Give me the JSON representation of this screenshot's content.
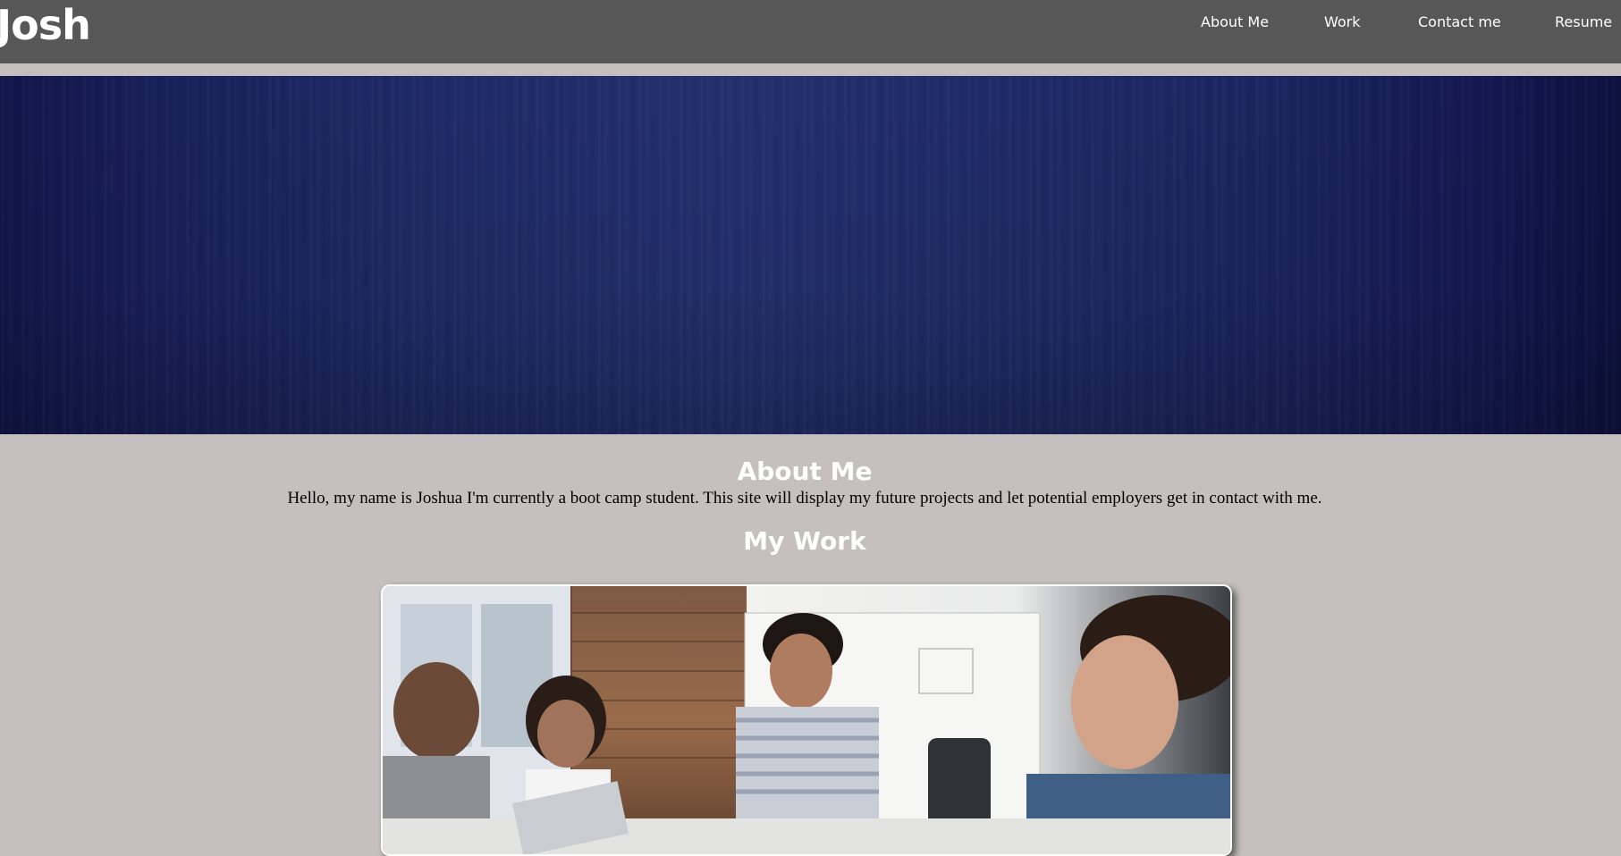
{
  "navbar": {
    "brand": "Josh",
    "links": [
      {
        "label": "About Me"
      },
      {
        "label": "Work"
      },
      {
        "label": "Contact me"
      },
      {
        "label": "Resume"
      }
    ]
  },
  "about": {
    "title": "About Me",
    "text": "Hello, my name is Joshua I'm currently a boot camp student. This site will display my future projects and let potential employers get in contact with me."
  },
  "work": {
    "title": "My Work"
  },
  "colors": {
    "navbar_bg": "#575757",
    "page_bg": "#c5bfbf",
    "hero_bg": "#1e2a66",
    "heading_text": "#ffffff"
  }
}
